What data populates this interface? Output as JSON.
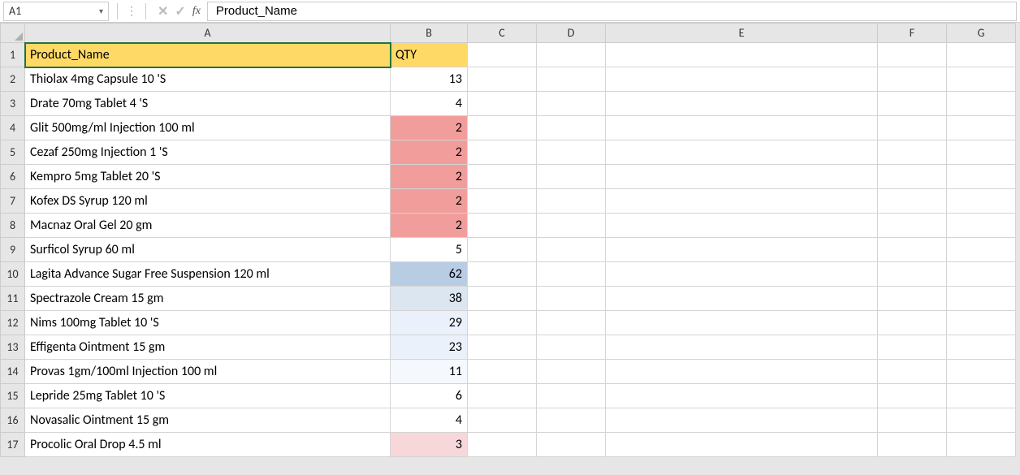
{
  "formula_bar": {
    "name_box": "A1",
    "formula_value": "Product_Name",
    "fx_label": "fx"
  },
  "columns": [
    "A",
    "B",
    "C",
    "D",
    "E",
    "F",
    "G"
  ],
  "headers": {
    "A": "Product_Name",
    "B": "QTY"
  },
  "rows": [
    {
      "n": 1,
      "A": "Product_Name",
      "B": "QTY",
      "is_header": true
    },
    {
      "n": 2,
      "A": "Thiolax 4mg Capsule 10 'S",
      "B": "13",
      "b_class": ""
    },
    {
      "n": 3,
      "A": "Drate 70mg Tablet 4 'S",
      "B": "4",
      "b_class": ""
    },
    {
      "n": 4,
      "A": "Glit 500mg/ml Injection 100 ml",
      "B": "2",
      "b_class": "red-fill"
    },
    {
      "n": 5,
      "A": "Cezaf 250mg Injection 1 'S",
      "B": "2",
      "b_class": "red-fill"
    },
    {
      "n": 6,
      "A": "Kempro 5mg Tablet 20 'S",
      "B": "2",
      "b_class": "red-fill"
    },
    {
      "n": 7,
      "A": "Kofex DS Syrup 120 ml",
      "B": "2",
      "b_class": "red-fill"
    },
    {
      "n": 8,
      "A": "Macnaz Oral Gel 20 gm",
      "B": "2",
      "b_class": "red-fill"
    },
    {
      "n": 9,
      "A": "Surficol Syrup 60 ml",
      "B": "5",
      "b_class": ""
    },
    {
      "n": 10,
      "A": "Lagita Advance Sugar Free Suspension 120 ml",
      "B": "62",
      "b_class": "blue-fill-dark"
    },
    {
      "n": 11,
      "A": "Spectrazole Cream 15 gm",
      "B": "38",
      "b_class": "blue-fill-med"
    },
    {
      "n": 12,
      "A": "Nims 100mg Tablet 10 'S",
      "B": "29",
      "b_class": "blue-fill-light"
    },
    {
      "n": 13,
      "A": "Effigenta Ointment 15 gm",
      "B": "23",
      "b_class": "blue-fill-light"
    },
    {
      "n": 14,
      "A": "Provas 1gm/100ml Injection 100 ml",
      "B": "11",
      "b_class": "blue-fill-vlight"
    },
    {
      "n": 15,
      "A": "Lepride 25mg Tablet 10 'S",
      "B": "6",
      "b_class": ""
    },
    {
      "n": 16,
      "A": "Novasalic Ointment 15 gm",
      "B": "4",
      "b_class": ""
    },
    {
      "n": 17,
      "A": "Procolic Oral Drop 4.5 ml",
      "B": "3",
      "b_class": "pink-fill"
    }
  ]
}
